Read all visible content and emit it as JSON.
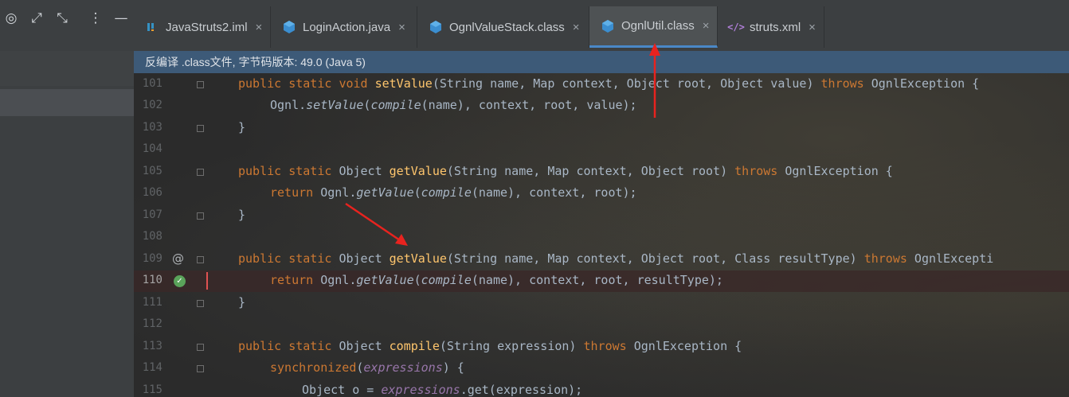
{
  "tabs": [
    {
      "label": "JavaStruts2.iml",
      "icon": "module-file-icon"
    },
    {
      "label": "LoginAction.java",
      "icon": "java-class-icon"
    },
    {
      "label": "OgnlValueStack.class",
      "icon": "class-file-icon"
    },
    {
      "label": "OgnlUtil.class",
      "icon": "class-file-icon",
      "active": true
    },
    {
      "label": "struts.xml",
      "icon": "xml-file-icon"
    }
  ],
  "close_glyph": "×",
  "banner": "反编译 .class文件, 字节码版本: 49.0 (Java 5)",
  "toolbar": {
    "target_glyph": "◎",
    "expand_glyph": "⤢",
    "collapse_glyph": "⤡",
    "menu_glyph": "⋮",
    "minimize_glyph": "—"
  },
  "gutter_marks": {
    "override": "@",
    "breakpoint": "✓"
  },
  "lines": [
    {
      "num": "101"
    },
    {
      "num": "102"
    },
    {
      "num": "103"
    },
    {
      "num": "104"
    },
    {
      "num": "105"
    },
    {
      "num": "106"
    },
    {
      "num": "107"
    },
    {
      "num": "108"
    },
    {
      "num": "109"
    },
    {
      "num": "110"
    },
    {
      "num": "111"
    },
    {
      "num": "112"
    },
    {
      "num": "113"
    },
    {
      "num": "114"
    },
    {
      "num": "115"
    }
  ],
  "code": {
    "t": {
      "public": "public",
      "static": "static",
      "void": "void",
      "return": "return",
      "throws": "throws",
      "synchronized": "synchronized",
      "setValue": "setValue",
      "getValue": "getValue",
      "compile": "compile",
      "expressions": "expressions",
      "sig101": "(String name, Map context, Object root, Object value) ",
      "exc": " OgnlException {",
      "ognl": "Ognl.",
      "call_mid": "(name), context, root, value);",
      "brace_close": "}",
      "obj": "Object ",
      "sig105": "(String name, Map context, Object root) ",
      "call106": "(name), context, root);",
      "sig109": "(String name, Map context, Object root, Class resultType) ",
      "exc109": " OgnlExcepti",
      "call110": "(name), context, root, resultType);",
      "sig113": "(String expression) ",
      "paren_open": "(",
      "sync_tail": ") {",
      "line115a": "Object o = ",
      "line115b": ".get(expression);"
    }
  },
  "colors": {
    "keyword": "#cc7832",
    "method": "#ffc66d",
    "field": "#9876aa",
    "text": "#a9b7c6",
    "banner": "#3d5a78",
    "accent": "#4a88c7"
  }
}
